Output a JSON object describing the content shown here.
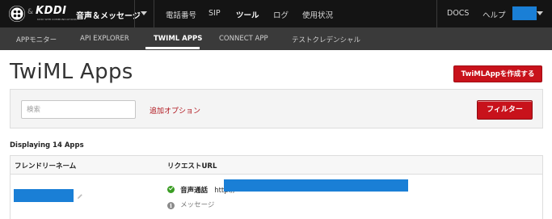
{
  "header": {
    "amp_symbol": "&",
    "brand": "KDDI",
    "brand_sub": "KDDI WEB COMMUNICATIONS",
    "product": "音声＆メッセージ",
    "nav": [
      {
        "label": "電話番号",
        "active": false
      },
      {
        "label": "SIP",
        "active": false
      },
      {
        "label": "ツール",
        "active": true
      },
      {
        "label": "ログ",
        "active": false
      },
      {
        "label": "使用状況",
        "active": false
      }
    ],
    "docs": "DOCS",
    "help": "ヘルプ"
  },
  "subnav": {
    "tabs": [
      {
        "label": "APPモニター",
        "active": false
      },
      {
        "label": "API EXPLORER",
        "active": false
      },
      {
        "label": "TWIML APPS",
        "active": true
      },
      {
        "label": "CONNECT APP",
        "active": false
      },
      {
        "label": "テストクレデンシャル",
        "active": false
      }
    ]
  },
  "page": {
    "title": "TwiML Apps",
    "create_button": "TwiMLAppを作成する"
  },
  "filter": {
    "search_placeholder": "検索",
    "advanced_link": "追加オプション",
    "filter_button": "フィルター"
  },
  "list": {
    "count_text": "Displaying 14 Apps",
    "columns": [
      "フレンドリーネーム",
      "リクエストURL"
    ],
    "rows": [
      {
        "voice_label": "音声通話",
        "url_prefix": "http://",
        "message_label": "メッセージ"
      }
    ]
  },
  "colors": {
    "topbar": "#141414",
    "subbar": "#3a3a3a",
    "accent_red": "#c8121b",
    "link_red": "#b0151d",
    "status_green": "#3a9d23",
    "redaction_blue": "#1a7fd6"
  }
}
